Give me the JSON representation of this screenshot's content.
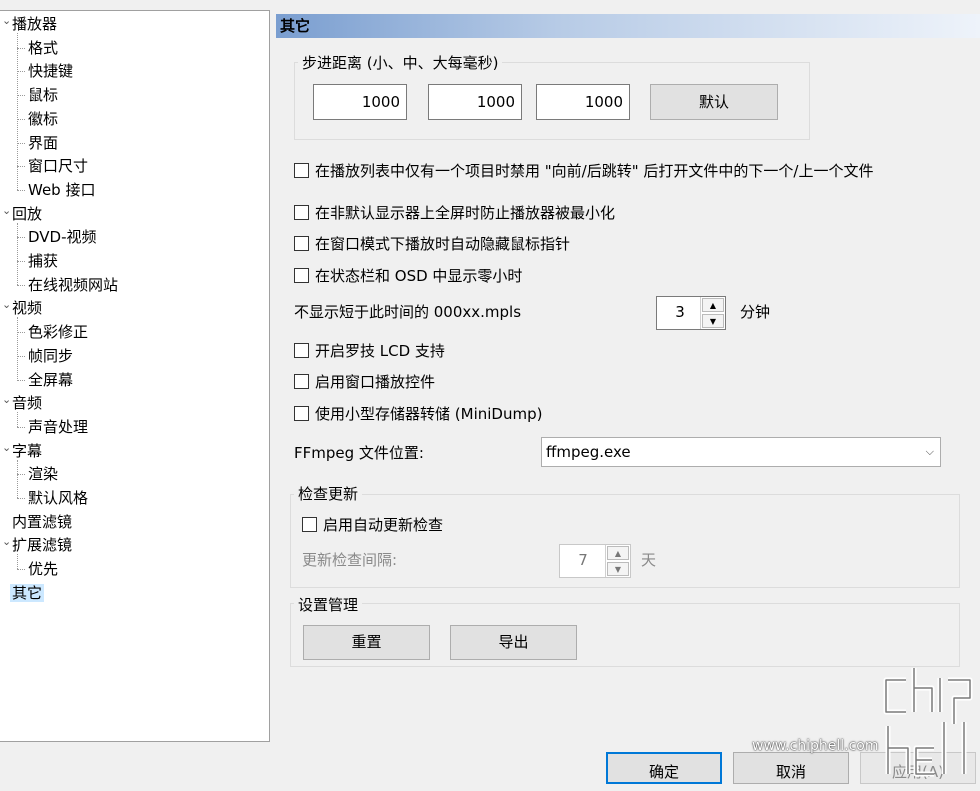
{
  "tree": {
    "items": [
      {
        "label": "播放器",
        "level": 0,
        "expanded": true
      },
      {
        "label": "格式",
        "level": 1
      },
      {
        "label": "快捷键",
        "level": 1
      },
      {
        "label": "鼠标",
        "level": 1
      },
      {
        "label": "徽标",
        "level": 1
      },
      {
        "label": "界面",
        "level": 1
      },
      {
        "label": "窗口尺寸",
        "level": 1
      },
      {
        "label": "Web 接口",
        "level": 1
      },
      {
        "label": "回放",
        "level": 0,
        "expanded": true
      },
      {
        "label": "DVD-视频",
        "level": 1
      },
      {
        "label": "捕获",
        "level": 1
      },
      {
        "label": "在线视频网站",
        "level": 1
      },
      {
        "label": "视频",
        "level": 0,
        "expanded": true
      },
      {
        "label": "色彩修正",
        "level": 1
      },
      {
        "label": "帧同步",
        "level": 1
      },
      {
        "label": "全屏幕",
        "level": 1
      },
      {
        "label": "音频",
        "level": 0,
        "expanded": true
      },
      {
        "label": "声音处理",
        "level": 1
      },
      {
        "label": "字幕",
        "level": 0,
        "expanded": true
      },
      {
        "label": "渲染",
        "level": 1
      },
      {
        "label": "默认风格",
        "level": 1
      },
      {
        "label": "内置滤镜",
        "level": 0
      },
      {
        "label": "扩展滤镜",
        "level": 0,
        "expanded": true
      },
      {
        "label": "优先",
        "level": 1
      },
      {
        "label": "其它",
        "level": 0,
        "selected": true
      }
    ]
  },
  "page": {
    "title": "其它",
    "step": {
      "group_label": "步进距离 (小、中、大每毫秒)",
      "small": "1000",
      "medium": "1000",
      "large": "1000",
      "default_button": "默认"
    },
    "checkboxes": [
      {
        "label": "在播放列表中仅有一个项目时禁用 \"向前/后跳转\" 后打开文件中的下一个/上一个文件",
        "checked": false
      },
      {
        "label": "在非默认显示器上全屏时防止播放器被最小化",
        "checked": false
      },
      {
        "label": "在窗口模式下播放时自动隐藏鼠标指针",
        "checked": false
      },
      {
        "label": "在状态栏和 OSD 中显示零小时",
        "checked": false
      }
    ],
    "mpls": {
      "label": "不显示短于此时间的 000xx.mpls",
      "value": "3",
      "unit": "分钟"
    },
    "checkboxes2": [
      {
        "label": "开启罗技 LCD 支持",
        "checked": false
      },
      {
        "label": "启用窗口播放控件",
        "checked": false
      },
      {
        "label": "使用小型存储器转储 (MiniDump)",
        "checked": false
      }
    ],
    "ffmpeg": {
      "label": "FFmpeg 文件位置:",
      "value": "ffmpeg.exe"
    },
    "update": {
      "group_label": "检查更新",
      "auto_check_label": "启用自动更新检查",
      "interval_label": "更新检查间隔:",
      "interval_value": "7",
      "interval_unit": "天"
    },
    "settings": {
      "group_label": "设置管理",
      "reset_button": "重置",
      "export_button": "导出"
    }
  },
  "footer": {
    "ok": "确定",
    "cancel": "取消",
    "apply": "应用(A)"
  },
  "watermark": {
    "logo_text": "chip hell",
    "url": "www.chiphell.com"
  }
}
